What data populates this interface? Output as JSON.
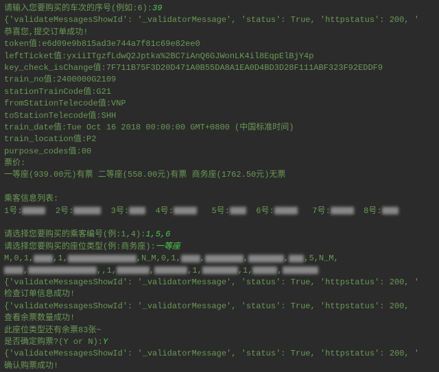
{
  "lines": {
    "prompt1": "请输入您要购买的车次的序号(例如:6):",
    "input1": "39",
    "resp1": "{'validateMessagesShowId': '_validatorMessage', 'status': True, 'httpstatus': 200, '",
    "msg1": "恭喜您,提交订单成功!",
    "token": "token值:e6d09e9b815ad3e744a7f81c69e82ee0",
    "leftTicket": "leftTicket值:yxiiITgzfLdwQ2Jptka%2BC7iAnQ6GJWonLK4il8EqpElBjY4p",
    "keyCheck": "key_check_isChange值:7F711B75F3D20D471A0B55DA8A1EA0D4BD3D28F111ABF323F92EDDF9",
    "trainNo": "train_no值:2400000G2109",
    "stationCode": "stationTrainCode值:G21",
    "fromTele": "fromStationTelecode值:VNP",
    "toTele": "toStationTelecode值:SHH",
    "trainDate": "train_date值:Tue Oct 16 2018 00:00:00 GMT+0800 (中国标准时间)",
    "trainLoc": "train_location值:P2",
    "purpose": "purpose_codes值:00",
    "price": "票价:",
    "seats": "一等座(939.00元)有票  二等座(558.00元)有票  商务座(1762.50元)无票",
    "passHeader": "乘客信息列表:",
    "p1": "1号:",
    "p2": "2号:",
    "p3": "3号:",
    "p4": "4号:",
    "p5": "5号:",
    "p6": "6号:",
    "p7": "7号:",
    "p8": "8号:",
    "prompt2": "请选择您要购买的乘客编号(例:1,4):",
    "input2": "1,5,6",
    "prompt3": "请选择您要购买的座位类型(例:商务座):",
    "input3": "一等座",
    "m1a": "M,0,1,",
    "m1b": ",1,",
    "m1c": ",N_M,0,1,",
    "m1d": ",",
    "m1e": ",5,N_M,",
    "m2a": ",",
    "m2b": ",,1,",
    "m2c": ",",
    "m2d": ",1,",
    "m2e": ",1,",
    "m2f": ",",
    "resp2": "{'validateMessagesShowId': '_validatorMessage', 'status': True, 'httpstatus': 200, '",
    "msg2": "检查订单信息成功!",
    "resp3": "{'validateMessagesShowId': '_validatorMessage', 'status': True, 'httpstatus': 200,",
    "msg3": "查看余票数量成功!",
    "msg4": "此座位类型还有余票83张~",
    "prompt4": "是否确定购票?(Y or N):",
    "input4": "Y",
    "resp4": "{'validateMessagesShowId': '_validatorMessage', 'status': True, 'httpstatus': 200, '",
    "msg5": "确认购票成功!"
  }
}
